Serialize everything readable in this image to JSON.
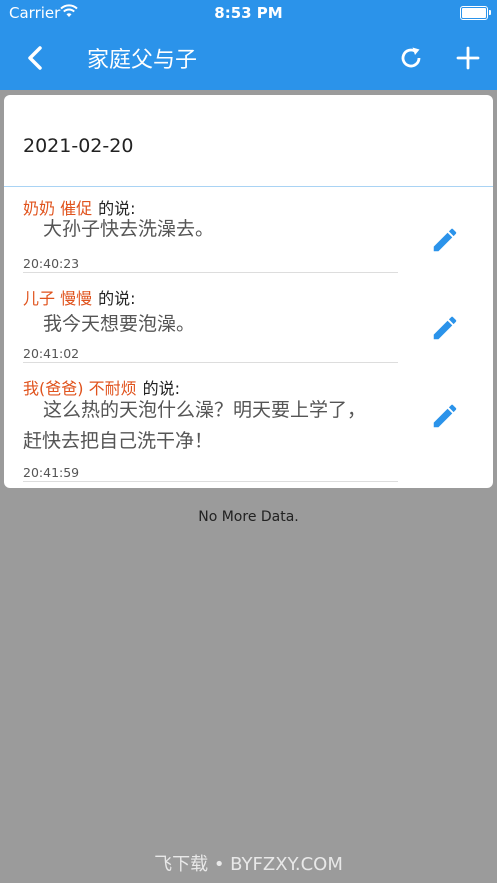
{
  "status_bar": {
    "carrier": "Carrier",
    "time": "8:53 PM"
  },
  "nav": {
    "title": "家庭父与子"
  },
  "date": "2021-02-20",
  "messages": [
    {
      "who": "奶奶 催促",
      "said": "的说:",
      "content": "大孙子快去洗澡去。",
      "time": "20:40:23"
    },
    {
      "who": "儿子 慢慢",
      "said": "的说:",
      "content": "我今天想要泡澡。",
      "time": "20:41:02"
    },
    {
      "who": "我(爸爸) 不耐烦",
      "said": "的说:",
      "content": "这么热的天泡什么澡？明天要上学了，赶快去把自己洗干净！",
      "time": "20:41:59"
    }
  ],
  "footer": {
    "no_more": "No More Data."
  },
  "watermark": "飞下载 • BYFZXY.COM",
  "colors": {
    "accent": "#2b93ea",
    "speaker": "#e0531d",
    "background": "#9b9b9b"
  },
  "icons": [
    "back-chevron-icon",
    "refresh-icon",
    "plus-icon",
    "pencil-edit-icon"
  ]
}
